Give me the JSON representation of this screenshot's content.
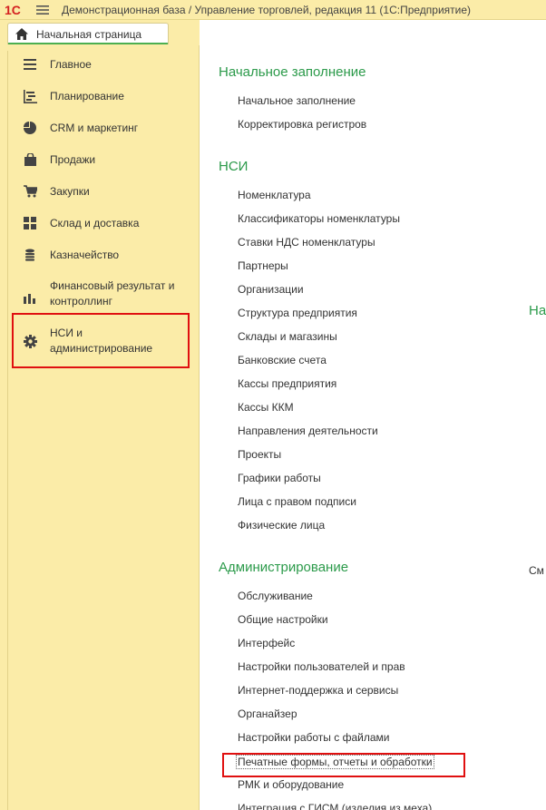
{
  "titlebar": {
    "logo_text": "1С",
    "title": "Демонстрационная база / Управление торговлей, редакция 11  (1С:Предприятие)"
  },
  "home_tab": {
    "label": "Начальная страница"
  },
  "sidebar": {
    "items": [
      {
        "label": "Главное",
        "icon": "menu-lines-icon"
      },
      {
        "label": "Планирование",
        "icon": "planning-icon"
      },
      {
        "label": "CRM и маркетинг",
        "icon": "pie-chart-icon"
      },
      {
        "label": "Продажи",
        "icon": "shopping-bag-icon"
      },
      {
        "label": "Закупки",
        "icon": "cart-icon"
      },
      {
        "label": "Склад и доставка",
        "icon": "warehouse-grid-icon"
      },
      {
        "label": "Казначейство",
        "icon": "coins-icon"
      },
      {
        "label": "Финансовый результат и контроллинг",
        "icon": "bar-chart-icon"
      },
      {
        "label": "НСИ и администрирование",
        "icon": "gear-icon",
        "selected": true
      }
    ]
  },
  "sections": {
    "initial": {
      "title": "Начальное заполнение",
      "links": [
        "Начальное заполнение",
        "Корректировка регистров"
      ]
    },
    "nsi": {
      "title": "НСИ",
      "links": [
        "Номенклатура",
        "Классификаторы номенклатуры",
        "Ставки НДС номенклатуры",
        "Партнеры",
        "Организации",
        "Структура предприятия",
        "Склады и магазины",
        "Банковские счета",
        "Кассы предприятия",
        "Кассы ККМ",
        "Направления деятельности",
        "Проекты",
        "Графики работы",
        "Лица с правом подписи",
        "Физические лица"
      ]
    },
    "admin": {
      "title": "Администрирование",
      "links": [
        "Обслуживание",
        "Общие настройки",
        "Интерфейс",
        "Настройки пользователей и прав",
        "Интернет-поддержка и сервисы",
        "Органайзер",
        "Настройки работы с файлами",
        "Печатные формы, отчеты и обработки",
        "РМК и оборудование",
        "Интеграция с ГИСМ (изделия из меха)"
      ]
    }
  },
  "cut_labels": {
    "right_section": "На",
    "right_link": "См"
  },
  "colors": {
    "sidebar_bg": "#fbeca8",
    "section_title": "#2b9a4a",
    "highlight": "#e01010",
    "accent": "#4caf50"
  }
}
